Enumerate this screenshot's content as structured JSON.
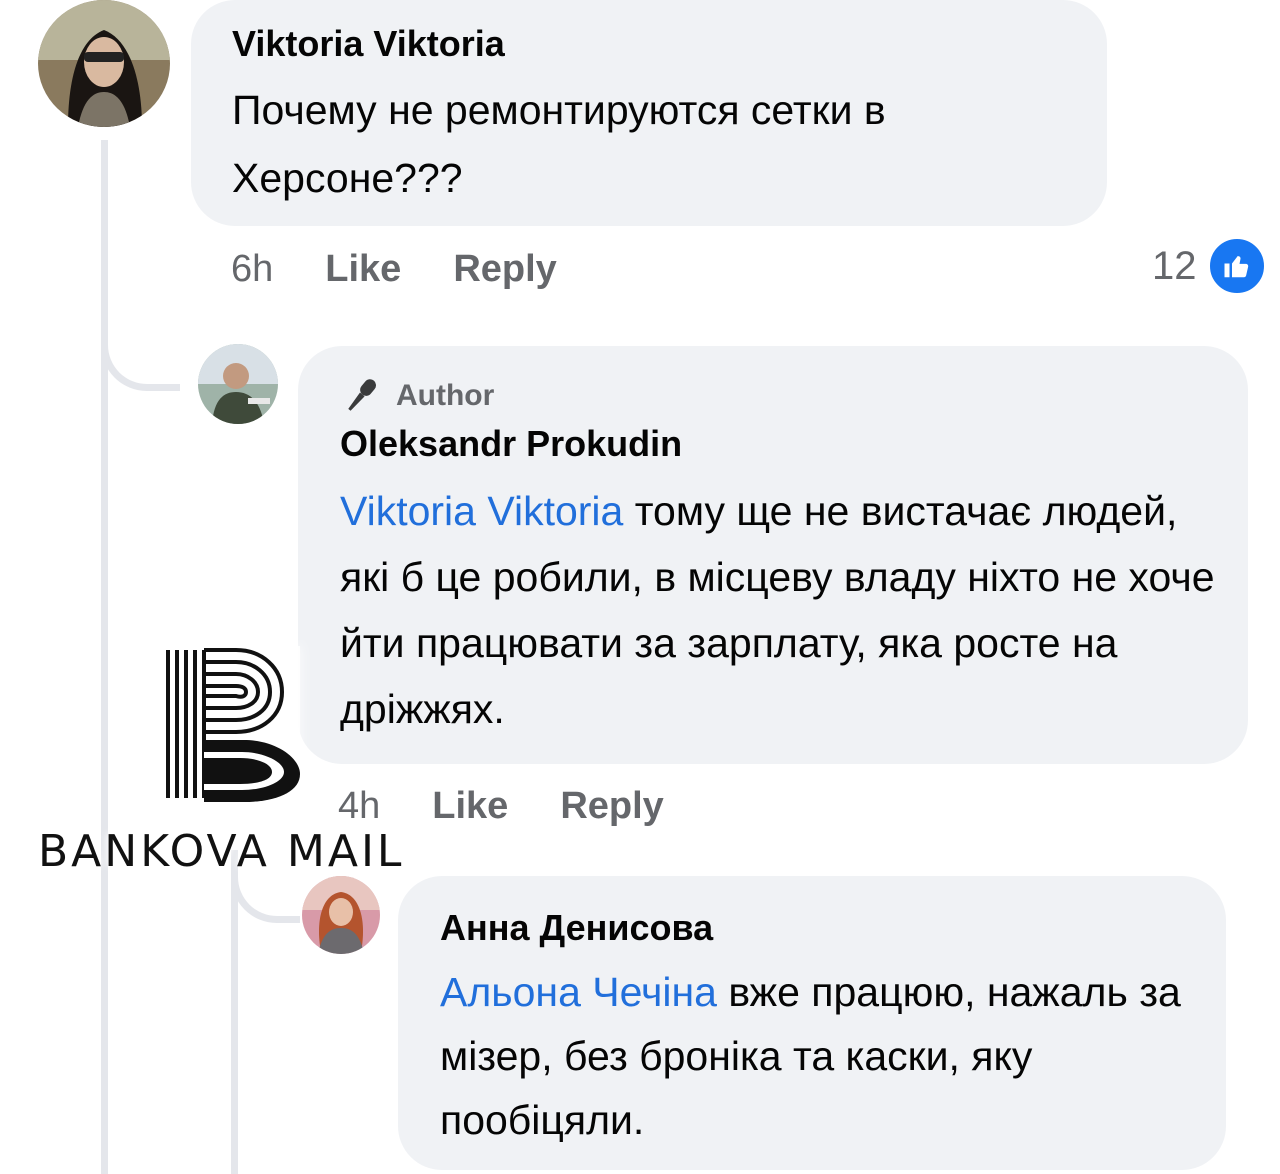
{
  "comments": [
    {
      "author": "Viktoria Viktoria",
      "text": "Почему не ремонтируются сетки в Херсоне???",
      "time": "6h",
      "like_label": "Like",
      "reply_label": "Reply",
      "reaction_count": "12"
    },
    {
      "badge": "Author",
      "author": "Oleksandr Prokudin",
      "mention": "Viktoria Viktoria",
      "text": " тому ще не вистачає людей, які б це робили, в місцеву владу ніхто не хоче йти працювати за зарплату, яка росте на дріжжях.",
      "time": "4h",
      "like_label": "Like",
      "reply_label": "Reply"
    },
    {
      "author": "Анна Денисова",
      "mention": "Альона Чечіна",
      "text": " вже працюю, нажаль за мізер, без броніка та каски, яку пообіцяли."
    }
  ],
  "watermark": {
    "text": "BANKOVA MAIL"
  },
  "colors": {
    "bubble": "#f0f2f5",
    "mention": "#216fdb",
    "meta": "#65676b",
    "like_badge": "#1877f2"
  }
}
